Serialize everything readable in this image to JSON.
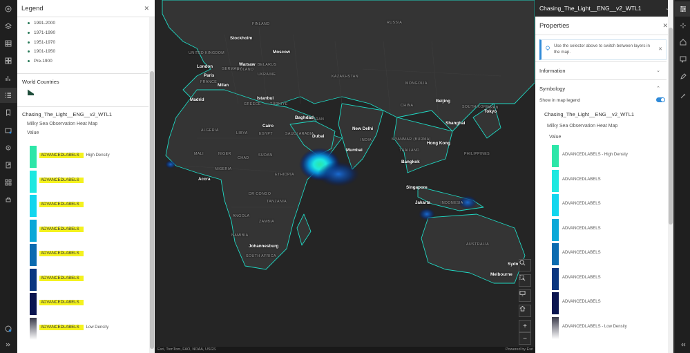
{
  "legend_panel": {
    "title": "Legend",
    "eras": [
      "1991-2000",
      "1971-1990",
      "1951-1970",
      "1901-1950",
      "Pre-1900"
    ],
    "world_countries_title": "World Countries",
    "layer_title": "Chasing_The_Light__ENG__v2_WTL1",
    "layer_subtitle": "Milky Sea Observation Heat Map",
    "value_label": "Value",
    "ramp": [
      {
        "label": "ADVANCEDLABELS",
        "density": "High Density",
        "color": "#2de6a8"
      },
      {
        "label": "ADVANCEDLABELS",
        "density": "",
        "color": "#1de8e0"
      },
      {
        "label": "ADVANCEDLABELS",
        "density": "",
        "color": "#12d6ee"
      },
      {
        "label": "ADVANCEDLABELS",
        "density": "",
        "color": "#0aa8d8"
      },
      {
        "label": "ADVANCEDLABELS",
        "density": "",
        "color": "#0b6bb0"
      },
      {
        "label": "ADVANCEDLABELS",
        "density": "",
        "color": "#0a3680"
      },
      {
        "label": "ADVANCEDLABELS",
        "density": "",
        "color": "#0a1550"
      },
      {
        "label": "ADVANCEDLABELS",
        "density": "Low Density",
        "color": "#3a3a4a"
      }
    ]
  },
  "map": {
    "labels": [
      {
        "text": "London"
      },
      {
        "text": "Paris"
      },
      {
        "text": "Milan"
      },
      {
        "text": "Madrid"
      },
      {
        "text": "Stockholm"
      },
      {
        "text": "Warsaw"
      },
      {
        "text": "Moscow"
      },
      {
        "text": "Istanbul"
      },
      {
        "text": "Cairo"
      },
      {
        "text": "Baghdad"
      },
      {
        "text": "Dubai"
      },
      {
        "text": "New Delhi"
      },
      {
        "text": "Mumbai"
      },
      {
        "text": "Beijing"
      },
      {
        "text": "Shanghai"
      },
      {
        "text": "Tokyo"
      },
      {
        "text": "Hong Kong"
      },
      {
        "text": "Bangkok"
      },
      {
        "text": "Singapore"
      },
      {
        "text": "Jakarta"
      },
      {
        "text": "Accra"
      },
      {
        "text": "Johannesburg"
      },
      {
        "text": "Sydn"
      },
      {
        "text": "Melbourne"
      }
    ],
    "country_labels": [
      "RUSSIA",
      "FINLAND",
      "UNITED KINGDOM",
      "GERMANY",
      "POLAND",
      "BELARUS",
      "UKRAINE",
      "KAZAKHSTAN",
      "MONGOLIA",
      "FRANCE",
      "GREECE",
      "TÜRKIYE",
      "ALGERIA",
      "LIBYA",
      "EGYPT",
      "SAUDI ARABIA",
      "IRAN",
      "INDIA",
      "MYANMAR (BURMA)",
      "SOUTH KOREA",
      "JAPAN",
      "MALI",
      "NIGER",
      "CHAD",
      "SUDAN",
      "NIGERIA",
      "ETHIOPIA",
      "DR CONGO",
      "TANZANIA",
      "ANGOLA",
      "NAMIBIA",
      "ZAMBIA",
      "SOUTH AFRICA",
      "INDONESIA",
      "AUSTRALIA",
      "CHINA",
      "PHILIPPINES",
      "THAILAND"
    ],
    "attribution": "Esri, TomTom, FAO, NOAA, USGS",
    "powered_by": "Powered by Esri"
  },
  "properties_panel": {
    "layer_name": "Chasing_The_Light__ENG__v2_WTL1",
    "title": "Properties",
    "notice": "Use the selector above to switch between layers in the map.",
    "information_label": "Information",
    "symbology_label": "Symbology",
    "show_legend_label": "Show in map legend",
    "layer_title": "Chasing_The_Light__ENG__v2_WTL1",
    "layer_subtitle": "Milky Sea Observation Heat Map",
    "value_label": "Value",
    "ramp_labels": [
      "ADVANCEDLABELS - High Density",
      "ADVANCEDLABELS",
      "ADVANCEDLABELS",
      "ADVANCEDLABELS",
      "ADVANCEDLABELS",
      "ADVANCEDLABELS",
      "ADVANCEDLABELS",
      "ADVANCEDLABELS - Low Density"
    ]
  },
  "colors": {
    "accent": "#2f8ad8",
    "highlight": "#f4f21e",
    "heat_core": "#2de6a8",
    "coastline": "#1de0c8"
  }
}
